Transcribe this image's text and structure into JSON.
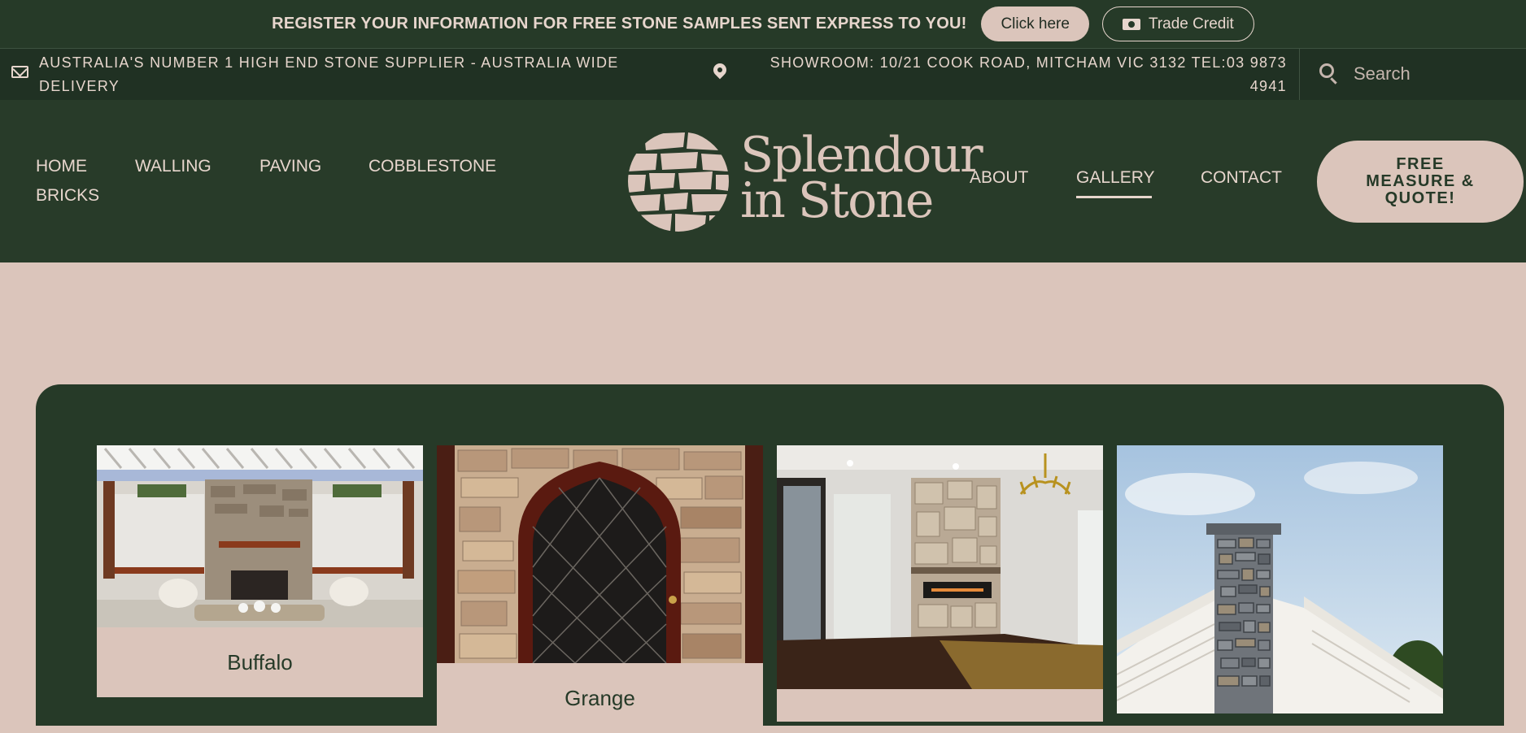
{
  "promo": {
    "text": "REGISTER YOUR INFORMATION FOR FREE STONE SAMPLES SENT EXPRESS TO YOU!",
    "click_label": "Click here",
    "trade_label": "Trade Credit"
  },
  "info": {
    "tagline": "AUSTRALIA'S NUMBER 1 HIGH END STONE SUPPLIER - AUSTRALIA WIDE DELIVERY",
    "showroom": "SHOWROOM: 10/21 COOK ROAD, MITCHAM VIC 3132 TEL:03 9873 4941",
    "search_placeholder": "Search"
  },
  "nav": {
    "left": [
      "HOME",
      "WALLING",
      "PAVING",
      "COBBLESTONE",
      "BRICKS"
    ],
    "right": [
      "ABOUT",
      "GALLERY",
      "CONTACT"
    ],
    "active": "GALLERY",
    "quote_label": "FREE MEASURE & QUOTE!"
  },
  "logo": {
    "line1": "Splendour",
    "line2": "in Stone"
  },
  "gallery": [
    {
      "caption": "Buffalo",
      "icon": "outdoor-fireplace-photo"
    },
    {
      "caption": "Grange",
      "icon": "arched-door-photo"
    },
    {
      "caption": "",
      "icon": "indoor-fireplace-photo"
    },
    {
      "caption": "",
      "icon": "stone-chimney-photo"
    }
  ],
  "colors": {
    "brand_green": "#263a28",
    "dark_green": "#203123",
    "blush": "#dbc5bb",
    "cream_text": "#e7d6cd"
  }
}
